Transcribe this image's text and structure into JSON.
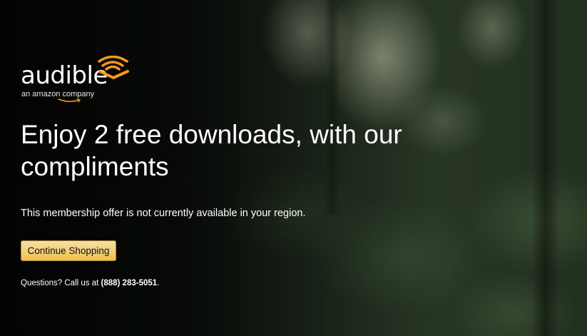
{
  "brand": {
    "name": "audible",
    "tagline": "an amazon company",
    "accent_color": "#f7991c"
  },
  "hero": {
    "headline": "Enjoy 2 free downloads, with our compliments",
    "message": "This membership offer is not currently available in your region.",
    "button_label": "Continue Shopping",
    "help_prefix": "Questions? Call us at ",
    "help_phone": "(888) 283-5051",
    "help_suffix": "."
  },
  "background": {
    "image_description": "forest"
  }
}
